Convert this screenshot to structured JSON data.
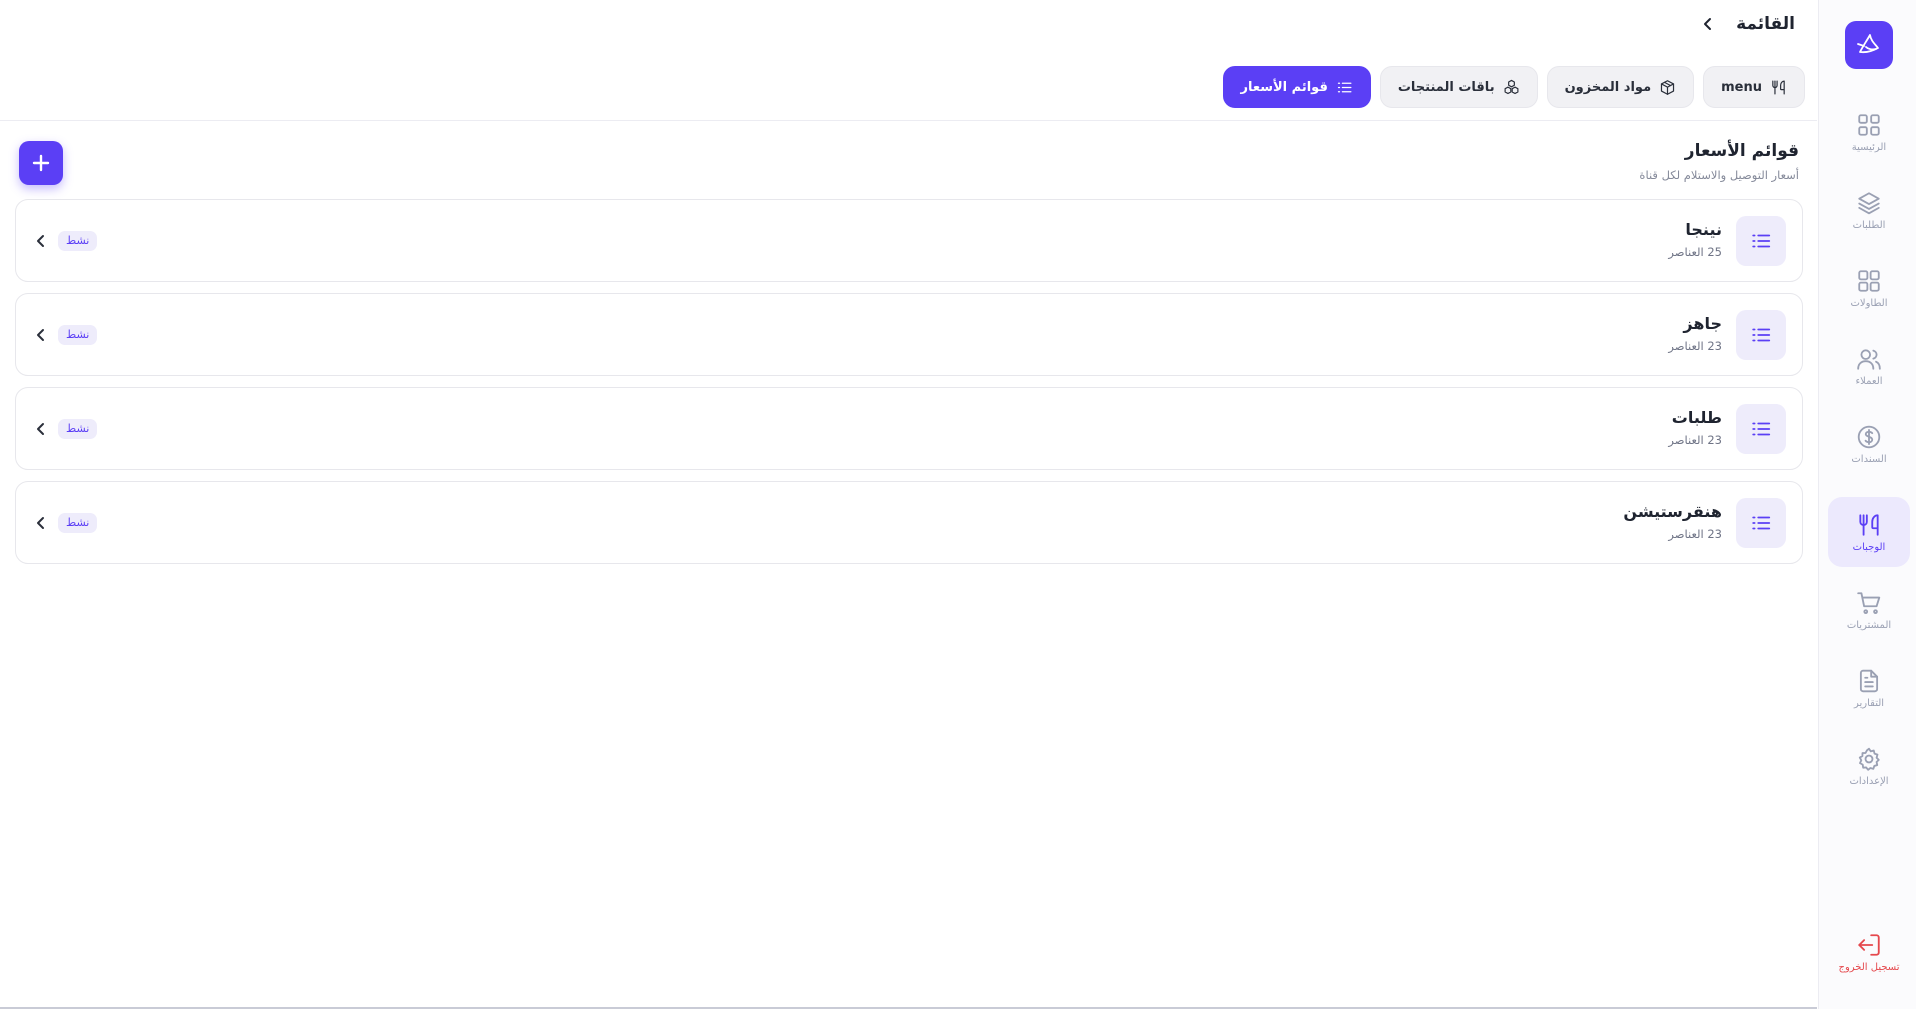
{
  "header": {
    "title": "القائمة",
    "tabs": [
      {
        "label": "menu",
        "icon": "utensils-icon"
      },
      {
        "label": "مواد المخزون",
        "icon": "box-icon"
      },
      {
        "label": "باقات المنتجات",
        "icon": "boxes-icon"
      },
      {
        "label": "قوائم الأسعار",
        "icon": "list-icon",
        "active": true
      }
    ]
  },
  "sidebar": {
    "items": [
      {
        "label": "الرئيسية",
        "icon": "grid-icon"
      },
      {
        "label": "الطلبات",
        "icon": "layers-icon"
      },
      {
        "label": "الطاولات",
        "icon": "table-grid-icon"
      },
      {
        "label": "العملاء",
        "icon": "users-icon"
      },
      {
        "label": "السندات",
        "icon": "dollar-circle-icon"
      },
      {
        "label": "الوجبات",
        "icon": "utensils-icon",
        "active": true
      },
      {
        "label": "المشتريات",
        "icon": "cart-icon"
      },
      {
        "label": "التقارير",
        "icon": "file-text-icon"
      },
      {
        "label": "الإعدادات",
        "icon": "gear-icon"
      }
    ],
    "logout_label": "تسجيل الخروج"
  },
  "section": {
    "title": "قوائم الأسعار",
    "subtitle": "أسعار التوصيل والاستلام لكل قناة"
  },
  "price_lists": [
    {
      "name": "نينجا",
      "count": "25 العناصر",
      "status": "نشط"
    },
    {
      "name": "جاهز",
      "count": "23 العناصر",
      "status": "نشط"
    },
    {
      "name": "طلبات",
      "count": "23 العناصر",
      "status": "نشط"
    },
    {
      "name": "هنقرستيشن",
      "count": "23 العناصر",
      "status": "نشط"
    }
  ],
  "colors": {
    "accent": "#5b3ff5",
    "accent_soft": "#eeecfb",
    "danger": "#e5484d"
  }
}
